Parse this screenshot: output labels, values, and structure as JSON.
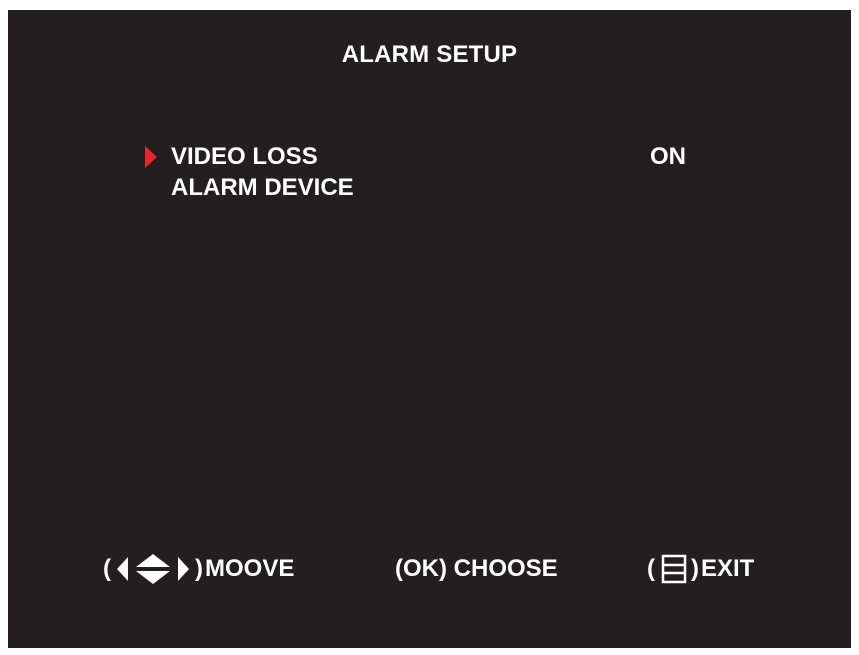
{
  "menu": {
    "title": "ALARM SETUP",
    "items": [
      {
        "label": "VIDEO LOSS",
        "value": "ON",
        "selected": true
      },
      {
        "label": "ALARM DEVICE",
        "value": "",
        "selected": false
      }
    ]
  },
  "footer": {
    "move": {
      "open": "(",
      "close": ")",
      "label": "MOOVE",
      "icon": "arrow-keys-icon"
    },
    "choose": {
      "label": "(OK) CHOOSE"
    },
    "exit": {
      "open": "(",
      "close": ")",
      "label": "EXIT",
      "icon": "menu-icon"
    }
  },
  "colors": {
    "background": "#231f20",
    "text": "#ffffff",
    "cursor": "#e8262b"
  }
}
